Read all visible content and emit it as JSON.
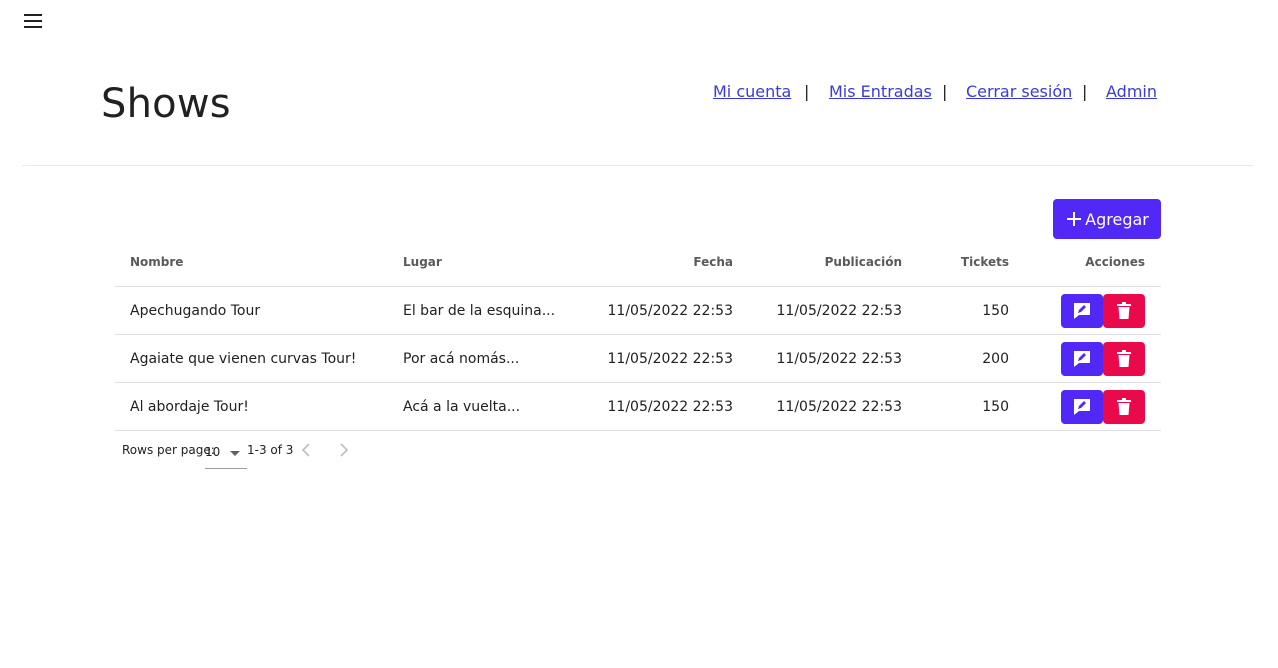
{
  "header": {
    "title": "Shows",
    "nav": [
      {
        "label": "Mi cuenta"
      },
      {
        "label": "Mis Entradas"
      },
      {
        "label": "Cerrar sesión"
      },
      {
        "label": "Admin"
      }
    ],
    "separator": "|"
  },
  "toolbar": {
    "add_label": "Agregar",
    "add_icon": "plus-icon"
  },
  "table": {
    "columns": [
      "Nombre",
      "Lugar",
      "Fecha",
      "Publicación",
      "Tickets",
      "Acciones"
    ],
    "rows": [
      {
        "nombre": "Apechugando Tour",
        "lugar": "El bar de la esquina...",
        "fecha": "11/05/2022 22:53",
        "publicacion": "11/05/2022 22:53",
        "tickets": "150"
      },
      {
        "nombre": "Agaiate que vienen curvas Tour!",
        "lugar": "Por acá nomás...",
        "fecha": "11/05/2022 22:53",
        "publicacion": "11/05/2022 22:53",
        "tickets": "200"
      },
      {
        "nombre": "Al abordaje Tour!",
        "lugar": "Acá a la vuelta...",
        "fecha": "11/05/2022 22:53",
        "publicacion": "11/05/2022 22:53",
        "tickets": "150"
      }
    ],
    "action_icons": [
      "edit-icon",
      "trash-icon"
    ]
  },
  "pagination": {
    "rows_per_page_label": "Rows per page:",
    "rows_per_page_value": "10",
    "range": "1-3 of 3"
  },
  "colors": {
    "primary": "#5128f5",
    "danger": "#ea0a4b",
    "link": "#3b3bd9"
  }
}
